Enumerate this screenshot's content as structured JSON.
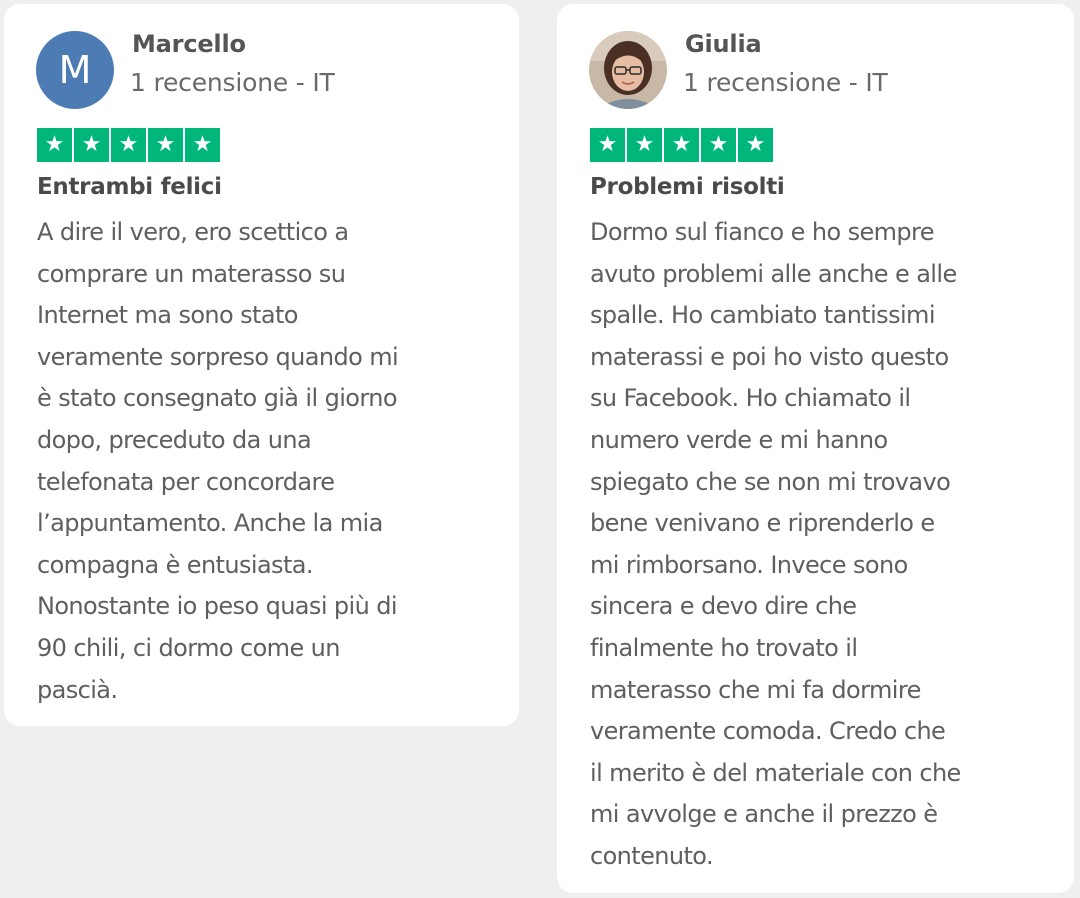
{
  "reviews": [
    {
      "avatar": {
        "type": "initial",
        "text": "M",
        "color": "#4d7bb3"
      },
      "name": "Marcello",
      "meta": "1 recensione - IT",
      "rating": 5,
      "star_color": "#00b67a",
      "title": "Entrambi felici",
      "body_lines": [
        "A dire il vero, ero scettico a",
        "comprare un materasso su",
        "Internet ma sono stato",
        "veramente sorpreso quando mi",
        "è stato consegnato già il giorno",
        "dopo, preceduto da una",
        "telefonata per concordare",
        "l’appuntamento. Anche la mia",
        "compagna è entusiasta.",
        "Nonostante io peso quasi più di",
        "90 chili, ci dormo come un",
        "pascià."
      ]
    },
    {
      "avatar": {
        "type": "photo",
        "icon": "woman-with-glasses-photo"
      },
      "name": "Giulia",
      "meta": "1 recensione - IT",
      "rating": 5,
      "star_color": "#00b67a",
      "title": "Problemi risolti",
      "body_lines": [
        "Dormo sul fianco e ho sempre",
        "avuto problemi alle anche e alle",
        "spalle. Ho cambiato tantissimi",
        "materassi e poi ho visto questo",
        "su Facebook. Ho chiamato il",
        "numero verde e mi hanno",
        "spiegato che se non mi trovavo",
        "bene venivano e riprenderlo e",
        "mi rimborsano. Invece sono",
        "sincera e devo dire che",
        "finalmente ho trovato il",
        "materasso che mi fa dormire",
        "veramente comoda. Credo che",
        "il merito è del materiale con che",
        "mi avvolge e anche il prezzo è",
        "contenuto."
      ]
    }
  ]
}
